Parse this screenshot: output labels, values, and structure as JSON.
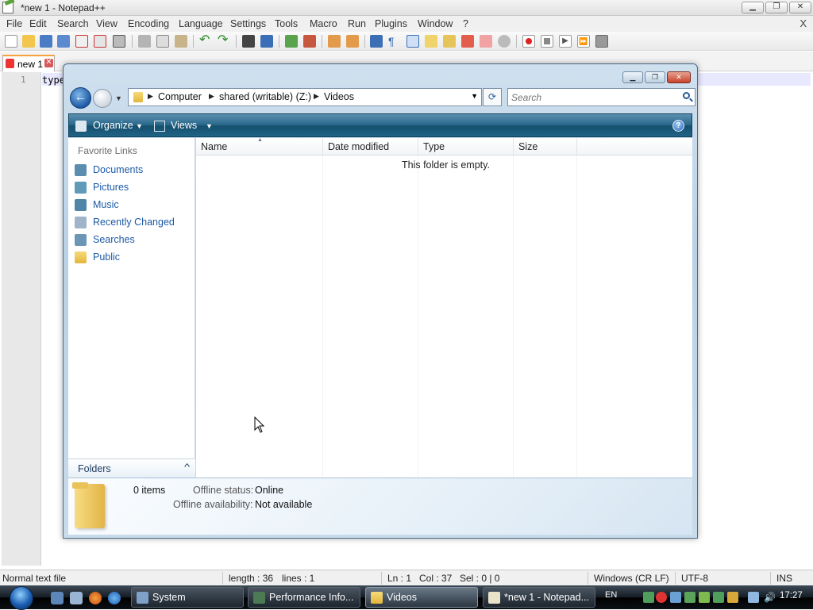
{
  "npp": {
    "title": "*new 1 - Notepad++",
    "menu": [
      "File",
      "Edit",
      "Search",
      "View",
      "Encoding",
      "Language",
      "Settings",
      "Tools",
      "Macro",
      "Run",
      "Plugins",
      "Window",
      "?"
    ],
    "menu_close": "X",
    "tab_label": "new 1",
    "line_number": "1",
    "code_text": "type",
    "status": {
      "file_type": "Normal text file",
      "length": "length : 36",
      "lines": "lines : 1",
      "ln": "Ln : 1",
      "col": "Col : 37",
      "sel": "Sel : 0 | 0",
      "eol": "Windows (CR LF)",
      "encoding": "UTF-8",
      "mode": "INS"
    }
  },
  "explorer": {
    "path": [
      "Computer",
      "shared (writable) (Z:)",
      "Videos"
    ],
    "search_placeholder": "Search",
    "toolbar": {
      "organize": "Organize",
      "views": "Views",
      "help": "?"
    },
    "nav": {
      "header": "Favorite Links",
      "items": [
        {
          "label": "Documents",
          "icon": "documents-icon"
        },
        {
          "label": "Pictures",
          "icon": "pictures-icon"
        },
        {
          "label": "Music",
          "icon": "music-icon"
        },
        {
          "label": "Recently Changed",
          "icon": "recently-changed-icon"
        },
        {
          "label": "Searches",
          "icon": "searches-icon"
        },
        {
          "label": "Public",
          "icon": "public-folder-icon"
        }
      ],
      "folders_label": "Folders",
      "folders_chevron": "^"
    },
    "columns": [
      "Name",
      "Date modified",
      "Type",
      "Size"
    ],
    "empty_message": "This folder is empty.",
    "details": {
      "items": "0 items",
      "offline_status_label": "Offline status:",
      "offline_status_value": "Online",
      "offline_availability_label": "Offline availability:",
      "offline_availability_value": "Not available"
    }
  },
  "taskbar": {
    "tasks": [
      {
        "label": "System",
        "active": false
      },
      {
        "label": "Performance Info...",
        "active": false
      },
      {
        "label": "Videos",
        "active": true
      },
      {
        "label": "*new 1 - Notepad...",
        "active": false
      }
    ],
    "language": "EN",
    "clock": "17:27"
  },
  "colors": {
    "explorer_cmdbar": "#206486",
    "link_blue": "#1d5aa7",
    "tab_accent": "#f7a13a"
  }
}
